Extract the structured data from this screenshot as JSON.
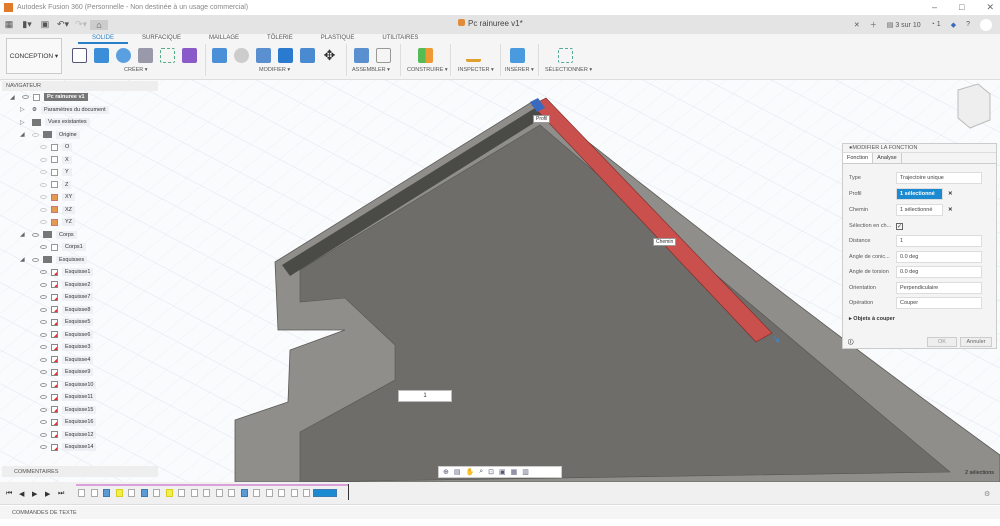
{
  "window": {
    "title": "Autodesk Fusion 360 (Personnelle - Non destinée à un usage commercial)",
    "doc_title": "Pc rainuree v1*",
    "jobs": "3 sur 10",
    "notifications": "1"
  },
  "ribbon": {
    "workspace": "CONCEPTION",
    "tabs": [
      "SOLIDE",
      "SURFACIQUE",
      "MAILLAGE",
      "TÔLERIE",
      "PLASTIQUE",
      "UTILITAIRES"
    ],
    "active_tab": "SOLIDE",
    "groups": [
      "CRÉER",
      "MODIFIER",
      "ASSEMBLER",
      "CONSTRUIRE",
      "INSPECTER",
      "INSÉRER",
      "SÉLECTIONNER"
    ]
  },
  "navigator": {
    "title": "NAVIGATEUR",
    "root": "Pc rainuree v1",
    "items": [
      "Paramètres du document",
      "Vues existantes",
      "Origine"
    ],
    "origin": [
      "O",
      "X",
      "Y",
      "Z",
      "XY",
      "XZ",
      "YZ"
    ],
    "bodies_folder": "Corps",
    "bodies": [
      "Corps1"
    ],
    "sketches_folder": "Esquisses",
    "sketches": [
      "Esquisse1",
      "Esquisse2",
      "Esquisse7",
      "Esquisse8",
      "Esquisse5",
      "Esquisse6",
      "Esquisse3",
      "Esquisse4",
      "Esquisse9",
      "Esquisse10",
      "Esquisse11",
      "Esquisse15",
      "Esquisse16",
      "Esquisse12",
      "Esquisse14"
    ]
  },
  "panel": {
    "title": "MODIFIER LA FONCTION",
    "tabs": [
      "Fonction",
      "Analyse"
    ],
    "fields": {
      "type_label": "Type",
      "type_value": "Trajectoire unique",
      "profil_label": "Profil",
      "profil_value": "1 sélectionné",
      "chemin_label": "Chemin",
      "chemin_value": "1 sélectionné",
      "chain_label": "Sélection en ch...",
      "distance_label": "Distance",
      "distance_value": "1",
      "conic_label": "Angle de conic...",
      "conic_value": "0.0 deg",
      "torsion_label": "Angle de torsion",
      "torsion_value": "0.0 deg",
      "orientation_label": "Orientation",
      "orientation_value": "Perpendiculaire",
      "operation_label": "Opération",
      "operation_value": "Couper"
    },
    "objects_label": "Objets à couper",
    "ok": "OK",
    "cancel": "Annuler"
  },
  "viewport": {
    "profile_tag": "Profil",
    "path_tag": "Chemin",
    "distance_input": "1",
    "status": "2 sélections",
    "colors": {
      "profile": "#c9504c",
      "body": "#8f8e8a",
      "floor": "#6e6d69"
    }
  },
  "comments": "COMMENTAIRES",
  "text_commands": "COMMANDES DE TEXTE"
}
